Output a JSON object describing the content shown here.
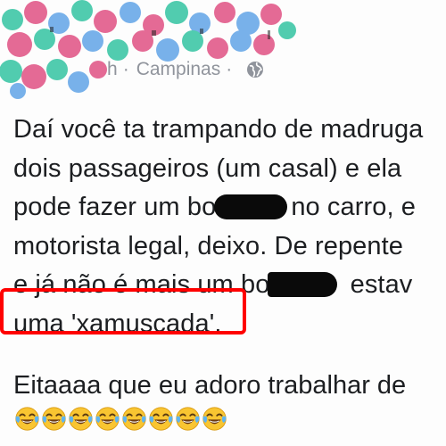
{
  "header": {
    "location": "Campinas",
    "separator": "·",
    "time_fragment": "h",
    "privacy_icon": "globe-icon"
  },
  "post": {
    "lines": [
      "Daí você ta trampando de madruga",
      "dois passageiros (um casal) e ela",
      "pode fazer um bo",
      "no carro, e",
      "motorista legal, deixo. De repente",
      "e já não é mais um bo",
      " estav",
      "uma 'xamuscada'."
    ],
    "closing": "Eitaaaa que eu adoro trabalhar de",
    "emoji_count": 8,
    "emoji_name": "face-with-tears-of-joy"
  },
  "colors": {
    "highlight": "#ff0000",
    "meta_text": "#90949c",
    "body_text": "#1c1e21",
    "redaction": "#0a0a0a",
    "emoji_face": "#f9c531"
  }
}
